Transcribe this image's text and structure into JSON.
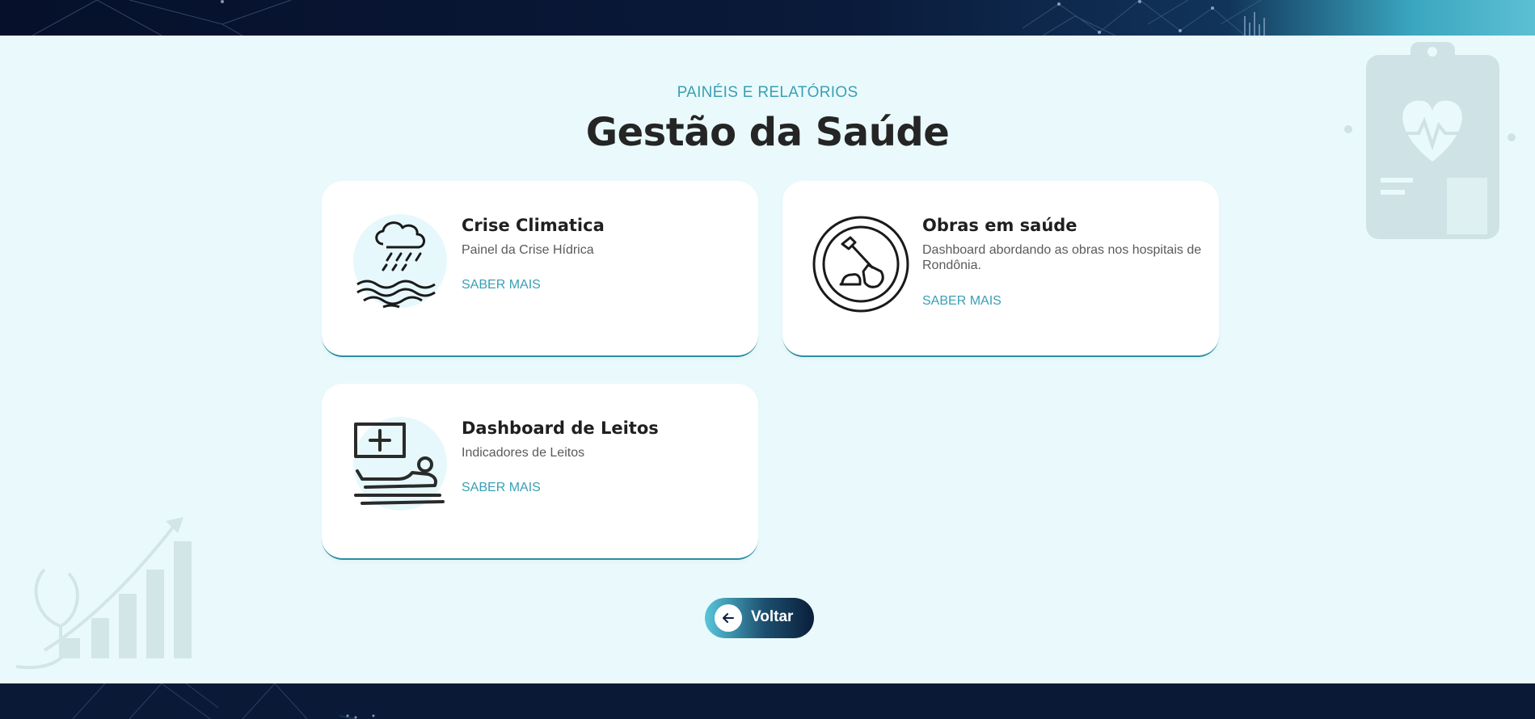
{
  "header": {
    "eyebrow": "PAINÉIS E RELATÓRIOS",
    "title": "Gestão da Saúde"
  },
  "cards": [
    {
      "title": "Crise Climatica",
      "description": "Painel da Crise Hídrica",
      "link": "SABER MAIS",
      "icon": "rain-flood-icon"
    },
    {
      "title": "Obras em saúde",
      "description": "Dashboard abordando as obras nos hospitais de Rondônia.",
      "link": "SABER MAIS",
      "icon": "shovel-construction-icon"
    },
    {
      "title": "Dashboard de Leitos",
      "description": "Indicadores de Leitos",
      "link": "SABER MAIS",
      "icon": "hospital-bed-icon"
    }
  ],
  "back_button": {
    "label": "Voltar",
    "icon": "arrow-left-icon"
  },
  "colors": {
    "accent": "#3a9fb5",
    "background": "#eafafc",
    "dark": "#0a1a36",
    "text": "#252525"
  }
}
